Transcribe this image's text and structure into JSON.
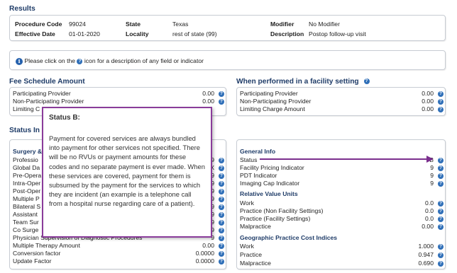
{
  "results": {
    "title": "Results",
    "procedure_code_label": "Procedure Code",
    "procedure_code": "99024",
    "effective_date_label": "Effective Date",
    "effective_date": "01-01-2020",
    "state_label": "State",
    "state": "Texas",
    "locality_label": "Locality",
    "locality": "rest of state (99)",
    "modifier_label": "Modifier",
    "modifier": "No Modifier",
    "description_label": "Description",
    "description": "Postop follow-up visit"
  },
  "notice": {
    "text_before": "Please click on the",
    "text_after": "icon for a description of any field or indicator"
  },
  "fee_schedule": {
    "title": "Fee Schedule Amount",
    "rows": [
      {
        "label": "Participating Provider",
        "value": "0.00"
      },
      {
        "label": "Non-Participating Provider",
        "value": "0.00"
      },
      {
        "label": "Limiting C",
        "value": ""
      }
    ]
  },
  "facility": {
    "title": "When performed in a facility setting",
    "rows": [
      {
        "label": "Participating Provider",
        "value": "0.00"
      },
      {
        "label": "Non-Participating Provider",
        "value": "0.00"
      },
      {
        "label": "Limiting Charge Amount",
        "value": "0.00"
      }
    ]
  },
  "status_indicators": {
    "title": "Status In",
    "surgery_title": "Surgery &",
    "rows": [
      {
        "label": "Professio",
        "value": "9"
      },
      {
        "label": "Global Da",
        "value": "X"
      },
      {
        "label": "Pre-Opera",
        "value": "9"
      },
      {
        "label": "Intra-Oper",
        "value": "9"
      },
      {
        "label": "Post-Oper",
        "value": "9"
      },
      {
        "label": "Multiple P",
        "value": "9"
      },
      {
        "label": "Bilateral S",
        "value": "9"
      },
      {
        "label": "Assistant",
        "value": "9"
      },
      {
        "label": "Team Sur",
        "value": "9"
      },
      {
        "label": "Co Surge",
        "value": "9"
      },
      {
        "label": "Physician Supervision of Diagnostic Procedures",
        "value": "9"
      },
      {
        "label": "Multiple Therapy Amount",
        "value": "0.00"
      },
      {
        "label": "Conversion factor",
        "value": "0.0000"
      },
      {
        "label": "Update Factor",
        "value": "0.0000"
      }
    ]
  },
  "general_info": {
    "title": "General Info",
    "rows": [
      {
        "label": "Status",
        "value": "B"
      },
      {
        "label": "Facility Pricing Indicator",
        "value": "9"
      },
      {
        "label": "PDT Indicator",
        "value": "9"
      },
      {
        "label": "Imaging Cap Indicator",
        "value": "9"
      }
    ],
    "rvu_title": "Relative Value Units",
    "rvu_rows": [
      {
        "label": "Work",
        "value": "0.0"
      },
      {
        "label": "Practice (Non Facility Settings)",
        "value": "0.0"
      },
      {
        "label": "Practice (Facility Settings)",
        "value": "0.0"
      },
      {
        "label": "Malpractice",
        "value": "0.00"
      }
    ],
    "gpci_title": "Geographic Practice Cost Indices",
    "gpci_rows": [
      {
        "label": "Work",
        "value": "1.000"
      },
      {
        "label": "Practice",
        "value": "0.947"
      },
      {
        "label": "Malpractice",
        "value": "0.690"
      }
    ]
  },
  "tooltip": {
    "title": "Status B:",
    "body": "Payment for covered services are always bundled into payment for other services not specified. There will be no RVUs or payment amounts for these codes and no separate payment is ever made. When these services are covered, payment for them is subsumed by the payment for the services to which they are incident (an example is a telephone call from a hospital nurse regarding care of a patient)."
  },
  "colors": {
    "heading": "#1f3c68",
    "help_icon": "#2f6fb8",
    "tooltip_border": "#8a3c9a",
    "arrow": "#7b2f8e"
  },
  "icons": {
    "help": "question-icon",
    "info": "info-icon"
  }
}
